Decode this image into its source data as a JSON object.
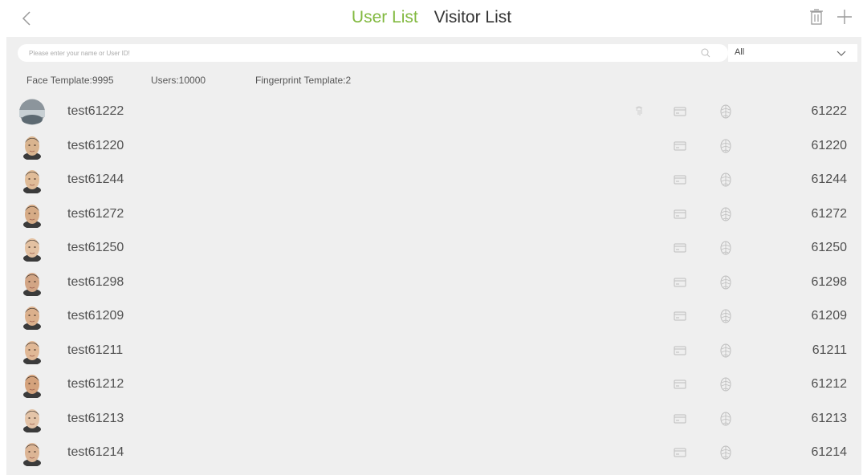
{
  "header": {
    "tabs": [
      {
        "label": "User List",
        "active": true
      },
      {
        "label": "Visitor List",
        "active": false
      }
    ],
    "icons": {
      "back": "chevron-left-icon",
      "delete": "trash-icon",
      "add": "plus-icon"
    }
  },
  "colors": {
    "accent": "#82b940",
    "background": "#efefef",
    "text": "#505050"
  },
  "search": {
    "placeholder": "Please enter your name or User ID!",
    "filter_value": "All"
  },
  "stats": {
    "face_template": "Face Template:9995",
    "users": "Users:10000",
    "fingerprint_template": "Fingerprint Template:2"
  },
  "users": [
    {
      "name": "test61222",
      "id": "61222",
      "fingerprint": true,
      "card": true,
      "face": true
    },
    {
      "name": "test61220",
      "id": "61220",
      "fingerprint": false,
      "card": true,
      "face": true
    },
    {
      "name": "test61244",
      "id": "61244",
      "fingerprint": false,
      "card": true,
      "face": true
    },
    {
      "name": "test61272",
      "id": "61272",
      "fingerprint": false,
      "card": true,
      "face": true
    },
    {
      "name": "test61250",
      "id": "61250",
      "fingerprint": false,
      "card": true,
      "face": true
    },
    {
      "name": "test61298",
      "id": "61298",
      "fingerprint": false,
      "card": true,
      "face": true
    },
    {
      "name": "test61209",
      "id": "61209",
      "fingerprint": false,
      "card": true,
      "face": true
    },
    {
      "name": "test61211",
      "id": "61211",
      "fingerprint": false,
      "card": true,
      "face": true
    },
    {
      "name": "test61212",
      "id": "61212",
      "fingerprint": false,
      "card": true,
      "face": true
    },
    {
      "name": "test61213",
      "id": "61213",
      "fingerprint": false,
      "card": true,
      "face": true
    },
    {
      "name": "test61214",
      "id": "61214",
      "fingerprint": false,
      "card": true,
      "face": true
    }
  ]
}
